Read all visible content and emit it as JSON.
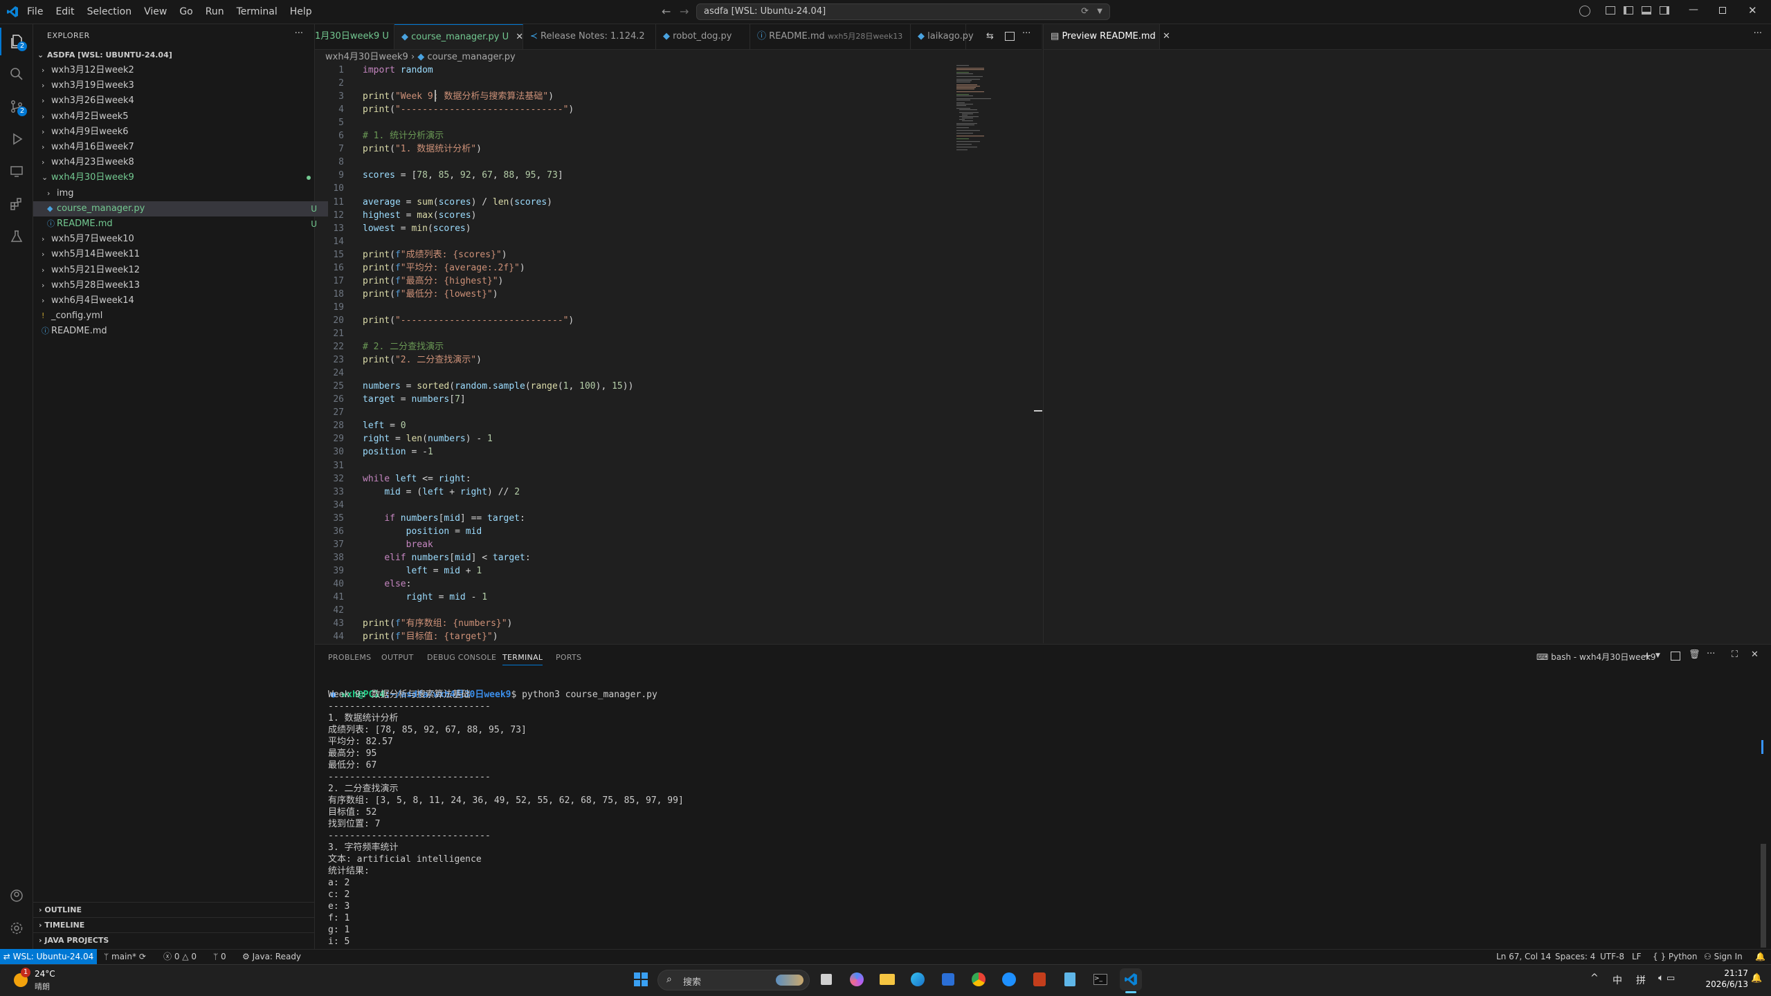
{
  "menu": [
    "File",
    "Edit",
    "Selection",
    "View",
    "Go",
    "Run",
    "Terminal",
    "Help"
  ],
  "command_center": "asdfa [WSL: Ubuntu-24.04]",
  "activity_badges": {
    "explorer": "2",
    "scm": "2"
  },
  "explorer": {
    "title": "EXPLORER",
    "root": "ASDFA [WSL: UBUNTU-24.04]",
    "items": [
      {
        "label": "wxh3月12日week2",
        "depth": 1,
        "type": "folder",
        "open": false
      },
      {
        "label": "wxh3月19日week3",
        "depth": 1,
        "type": "folder",
        "open": false
      },
      {
        "label": "wxh3月26日week4",
        "depth": 1,
        "type": "folder",
        "open": false
      },
      {
        "label": "wxh4月2日week5",
        "depth": 1,
        "type": "folder",
        "open": false
      },
      {
        "label": "wxh4月9日week6",
        "depth": 1,
        "type": "folder",
        "open": false
      },
      {
        "label": "wxh4月16日week7",
        "depth": 1,
        "type": "folder",
        "open": false
      },
      {
        "label": "wxh4月23日week8",
        "depth": 1,
        "type": "folder",
        "open": false
      },
      {
        "label": "wxh4月30日week9",
        "depth": 1,
        "type": "folder",
        "open": true
      },
      {
        "label": "img",
        "depth": 2,
        "type": "folder",
        "open": false
      },
      {
        "label": "course_manager.py",
        "depth": 2,
        "type": "py",
        "status": "U"
      },
      {
        "label": "README.md",
        "depth": 2,
        "type": "md",
        "status": "U"
      },
      {
        "label": "wxh5月7日week10",
        "depth": 1,
        "type": "folder",
        "open": false
      },
      {
        "label": "wxh5月14日week11",
        "depth": 1,
        "type": "folder",
        "open": false
      },
      {
        "label": "wxh5月21日week12",
        "depth": 1,
        "type": "folder",
        "open": false
      },
      {
        "label": "wxh5月28日week13",
        "depth": 1,
        "type": "folder",
        "open": false
      },
      {
        "label": "wxh6月4日week14",
        "depth": 1,
        "type": "folder",
        "open": false
      },
      {
        "label": "_config.yml",
        "depth": 1,
        "type": "yml"
      },
      {
        "label": "README.md",
        "depth": 1,
        "type": "md"
      }
    ],
    "sections": [
      "OUTLINE",
      "TIMELINE",
      "JAVA PROJECTS"
    ]
  },
  "tabs": [
    {
      "label": "1月30日week9",
      "status": "U"
    },
    {
      "label": "course_manager.py",
      "status": "U"
    },
    {
      "label": "Release Notes: 1.124.2",
      "status": ""
    },
    {
      "label": "robot_dog.py",
      "status": ""
    },
    {
      "label": "README.md",
      "status": "wxh5月28日week13"
    },
    {
      "label": "laikago.py",
      "status": ""
    }
  ],
  "preview_tab": "Preview README.md",
  "breadcrumb": {
    "folder": "wxh4月30日week9",
    "file": "course_manager.py"
  },
  "code": [
    "import random",
    "",
    "print(\"Week 9: 数据分析与搜索算法基础\")",
    "print(\"------------------------------\")",
    "",
    "# 1. 统计分析演示",
    "print(\"1. 数据统计分析\")",
    "",
    "scores = [78, 85, 92, 67, 88, 95, 73]",
    "",
    "average = sum(scores) / len(scores)",
    "highest = max(scores)",
    "lowest = min(scores)",
    "",
    "print(f\"成绩列表: {scores}\")",
    "print(f\"平均分: {average:.2f}\")",
    "print(f\"最高分: {highest}\")",
    "print(f\"最低分: {lowest}\")",
    "",
    "print(\"------------------------------\")",
    "",
    "# 2. 二分查找演示",
    "print(\"2. 二分查找演示\")",
    "",
    "numbers = sorted(random.sample(range(1, 100), 15))",
    "target = numbers[7]",
    "",
    "left = 0",
    "right = len(numbers) - 1",
    "position = -1",
    "",
    "while left <= right:",
    "    mid = (left + right) // 2",
    "",
    "    if numbers[mid] == target:",
    "        position = mid",
    "        break",
    "    elif numbers[mid] < target:",
    "        left = mid + 1",
    "    else:",
    "        right = mid - 1",
    "",
    "print(f\"有序数组: {numbers}\")",
    "print(f\"目标值: {target}\")"
  ],
  "panel": {
    "tabs": [
      "PROBLEMS",
      "OUTPUT",
      "DEBUG CONSOLE",
      "TERMINAL",
      "PORTS"
    ],
    "active": "TERMINAL",
    "shell": "bash - wxh4月30日week9",
    "prompt": {
      "user": "wxh@PC14",
      "path": ":~/asdfa/wxh4月30日week9",
      "command": "$ python3 course_manager.py"
    },
    "output": [
      "Week 9: 数据分析与搜索算法基础",
      "------------------------------",
      "1. 数据统计分析",
      "成绩列表: [78, 85, 92, 67, 88, 95, 73]",
      "平均分: 82.57",
      "最高分: 95",
      "最低分: 67",
      "------------------------------",
      "2. 二分查找演示",
      "有序数组: [3, 5, 8, 11, 24, 36, 49, 52, 55, 62, 68, 75, 85, 97, 99]",
      "目标值: 52",
      "找到位置: 7",
      "------------------------------",
      "3. 字符频率统计",
      "文本: artificial intelligence",
      "统计结果:",
      "a: 2",
      "c: 2",
      "e: 3",
      "f: 1",
      "g: 1",
      "i: 5"
    ]
  },
  "status": {
    "remote": "WSL: Ubuntu-24.04",
    "branch": "main*",
    "problems": "0",
    "warnings": "0",
    "ports": "0",
    "java": "Java: Ready",
    "cursor": "Ln 67, Col 14",
    "spaces": "Spaces: 4",
    "encoding": "UTF-8",
    "eol": "LF",
    "language": "Python",
    "signin": "Sign In"
  },
  "taskbar": {
    "weather_temp": "24°C",
    "weather_text": "晴朗",
    "weather_badge": "1",
    "search": "搜索",
    "ime_lang": "中",
    "ime_mode": "拼",
    "time": "21:17",
    "date": "2026/6/13"
  }
}
